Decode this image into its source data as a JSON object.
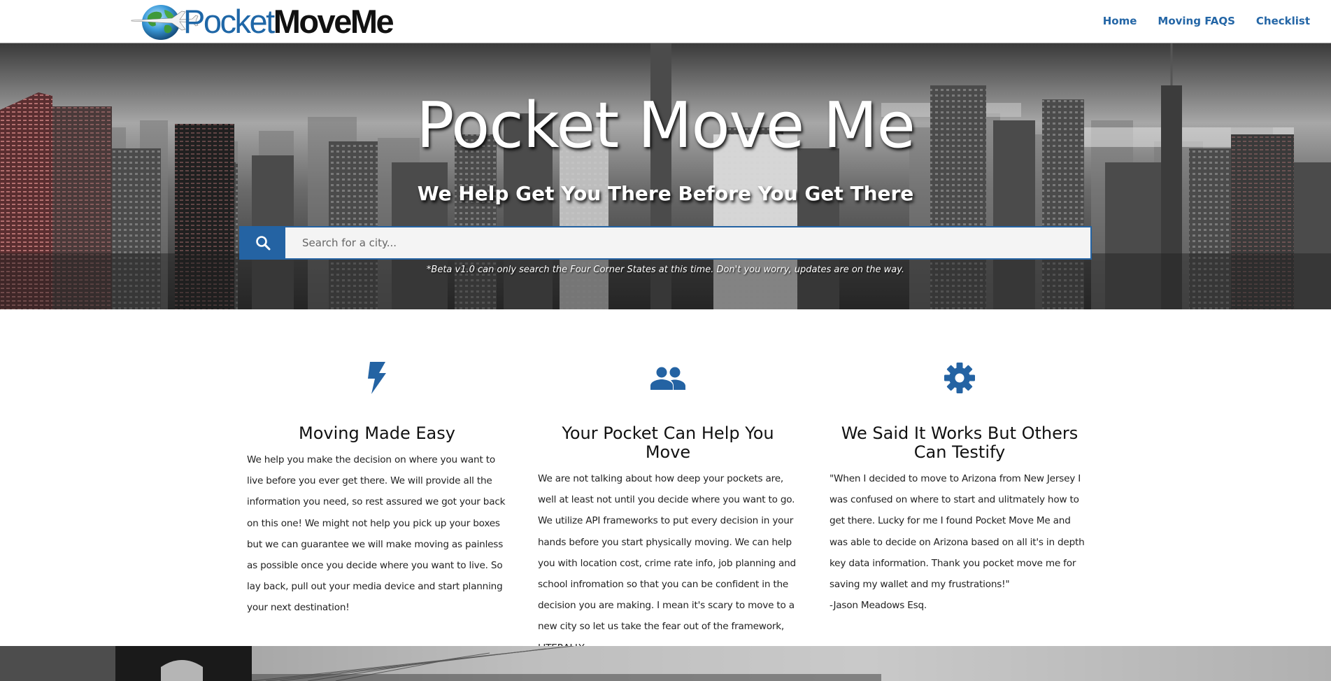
{
  "brand": {
    "logo_part1": "Pocket",
    "logo_part2": "MoveMe",
    "primary_color": "#2463a3"
  },
  "nav": {
    "items": [
      {
        "label": "Home"
      },
      {
        "label": "Moving FAQS"
      },
      {
        "label": "Checklist"
      }
    ]
  },
  "hero": {
    "title": "Pocket Move Me",
    "subtitle": "We Help Get You There Before You Get There",
    "search_placeholder": "Search for a city...",
    "search_icon": "search-icon",
    "beta_note": "*Beta v1.0 can only search the Four Corner States at this time. Don't you worry, updates are on the way."
  },
  "features": [
    {
      "icon": "lightning-bolt-icon",
      "title": "Moving Made Easy",
      "body": "We help you make the decision on where you want to live before you ever get there. We will provide all the information you need, so rest assured we got your back on this one! We might not help you pick up your boxes but we can guarantee we will make moving as painless as possible once you decide where you want to live. So lay back, pull out your media device and start planning your next destination!"
    },
    {
      "icon": "people-icon",
      "title": "Your Pocket Can Help You Move",
      "body": "We are not talking about how deep your pockets are, well at least not until you decide where you want to go. We utilize API frameworks to put every decision in your hands before you start physically moving. We can help you with location cost, crime rate info, job planning and school infromation so that you can be confident in the decision you are making. I mean it's scary to move to a new city so let us take the fear out of the framework, LITERALLY."
    },
    {
      "icon": "gear-icon",
      "title": "We Said It Works But Others Can Testify",
      "body": "\"When I decided to move to Arizona from New Jersey I was confused on where to start and ulitmately how to get there. Lucky for me I found Pocket Move Me and was able to decide on Arizona based on all it's in depth key data information. Thank you pocket move me for saving my wallet and my frustrations!\"",
      "signature": "-Jason Meadows Esq."
    }
  ]
}
